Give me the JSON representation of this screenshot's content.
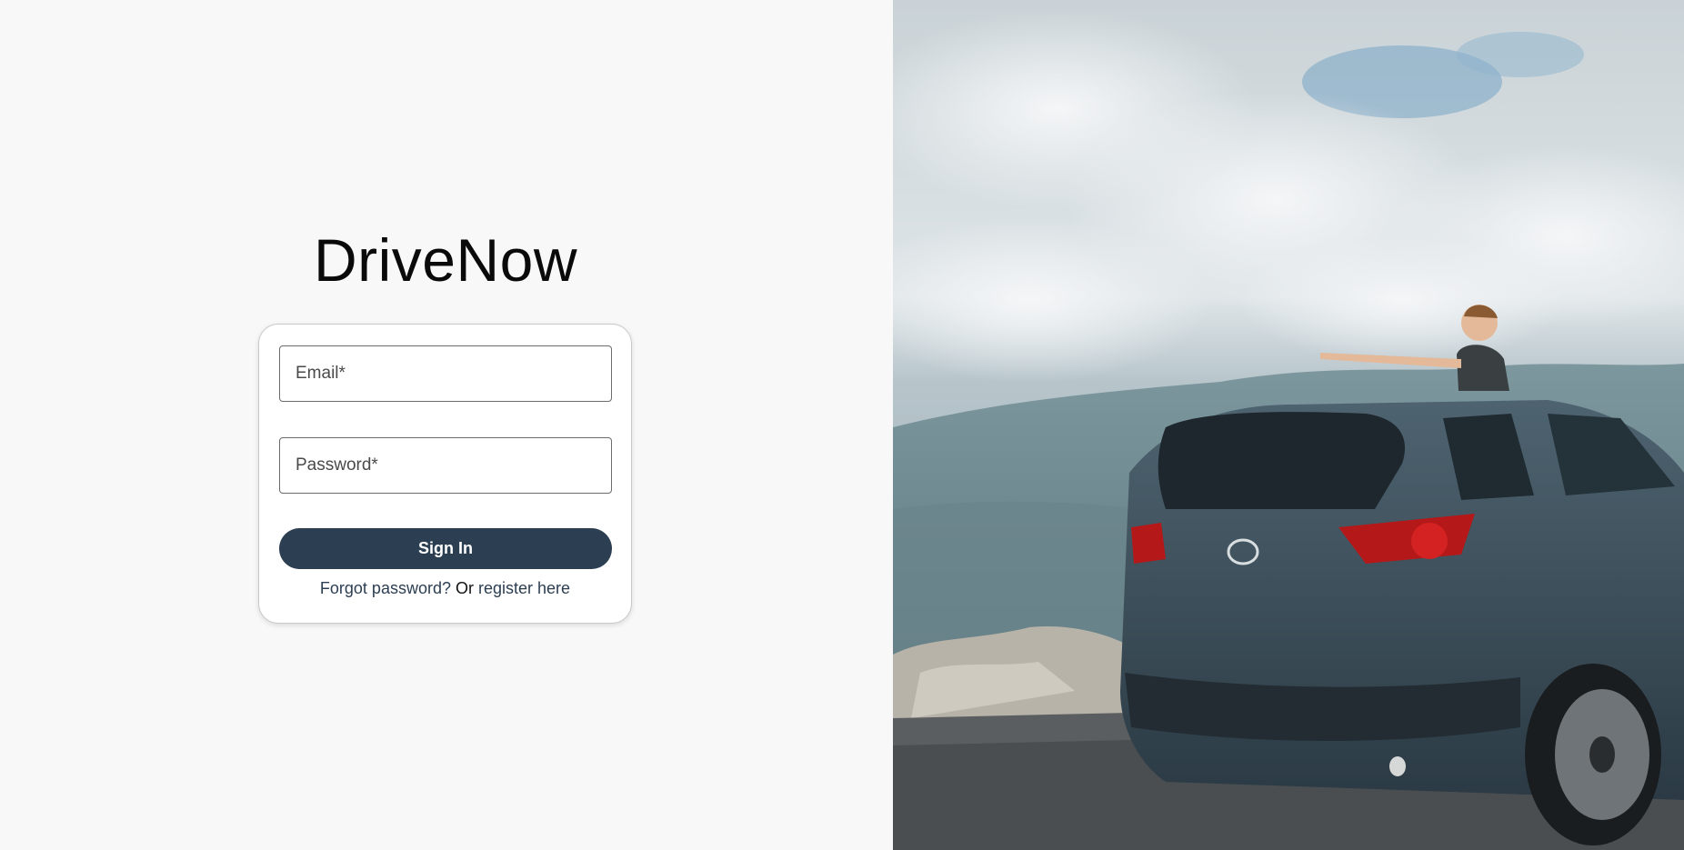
{
  "brand": {
    "title": "DriveNow"
  },
  "login": {
    "email_placeholder": "Email*",
    "email_value": "",
    "password_placeholder": "Password*",
    "password_value": "",
    "signin_label": "Sign In",
    "forgot_label": "Forgot password?",
    "or_text": "Or",
    "register_label": "register here"
  },
  "hero": {
    "image": "car-on-mountain-photo"
  },
  "colors": {
    "background": "#f8f8f8",
    "primary": "#2c3e52",
    "card": "#ffffff",
    "border": "#c9c9c9"
  }
}
